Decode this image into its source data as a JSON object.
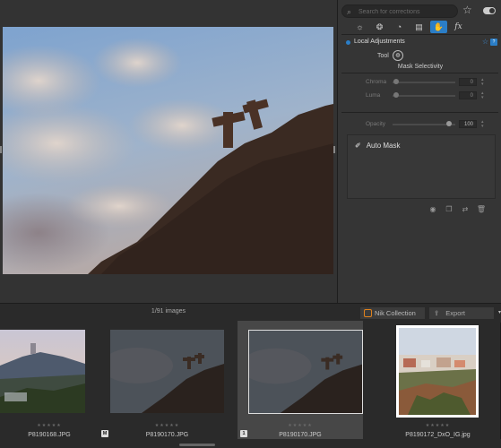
{
  "search": {
    "placeholder": "Search for corrections"
  },
  "icons": {
    "search": "search-icon",
    "favorites": "star-icon",
    "toggle": "toggle-switch",
    "tabs": [
      "light-icon",
      "color-icon",
      "detail-icon",
      "geometry-icon",
      "local-adjustments-icon",
      "fx-icon"
    ],
    "mask_actions": [
      "eye-icon",
      "duplicate-icon",
      "swap-icon",
      "trash-icon"
    ]
  },
  "tool_tabs": {
    "fx_label": "fx"
  },
  "local_adjustments": {
    "title": "Local Adjustments",
    "help": "?",
    "tool_label": "Tool",
    "mask_selectivity": "Mask Selectivity",
    "chroma": {
      "label": "Chroma",
      "value": "0",
      "level": 0
    },
    "luma": {
      "label": "Luma",
      "value": "0",
      "level": 0
    },
    "opacity": {
      "label": "Opacity",
      "value": "100",
      "level": 1
    },
    "mask_item": "Auto Mask"
  },
  "status": {
    "count": "1/91 images"
  },
  "buttons": {
    "nik": "Nik Collection",
    "export": "Export"
  },
  "filmstrip": [
    {
      "name": "P8190168.JPG",
      "stars": "★★★★★",
      "badge": ""
    },
    {
      "name": "P8190170.JPG",
      "stars": "★★★★★",
      "badge": "M"
    },
    {
      "name": "P8190170.JPG",
      "stars": "★★★★★",
      "badge": "1"
    },
    {
      "name": "P8190172_DxO_IG.jpg",
      "stars": "★★★★★",
      "badge": ""
    }
  ],
  "colors": {
    "accent": "#2b7ec7",
    "nik": "#e0821d"
  }
}
